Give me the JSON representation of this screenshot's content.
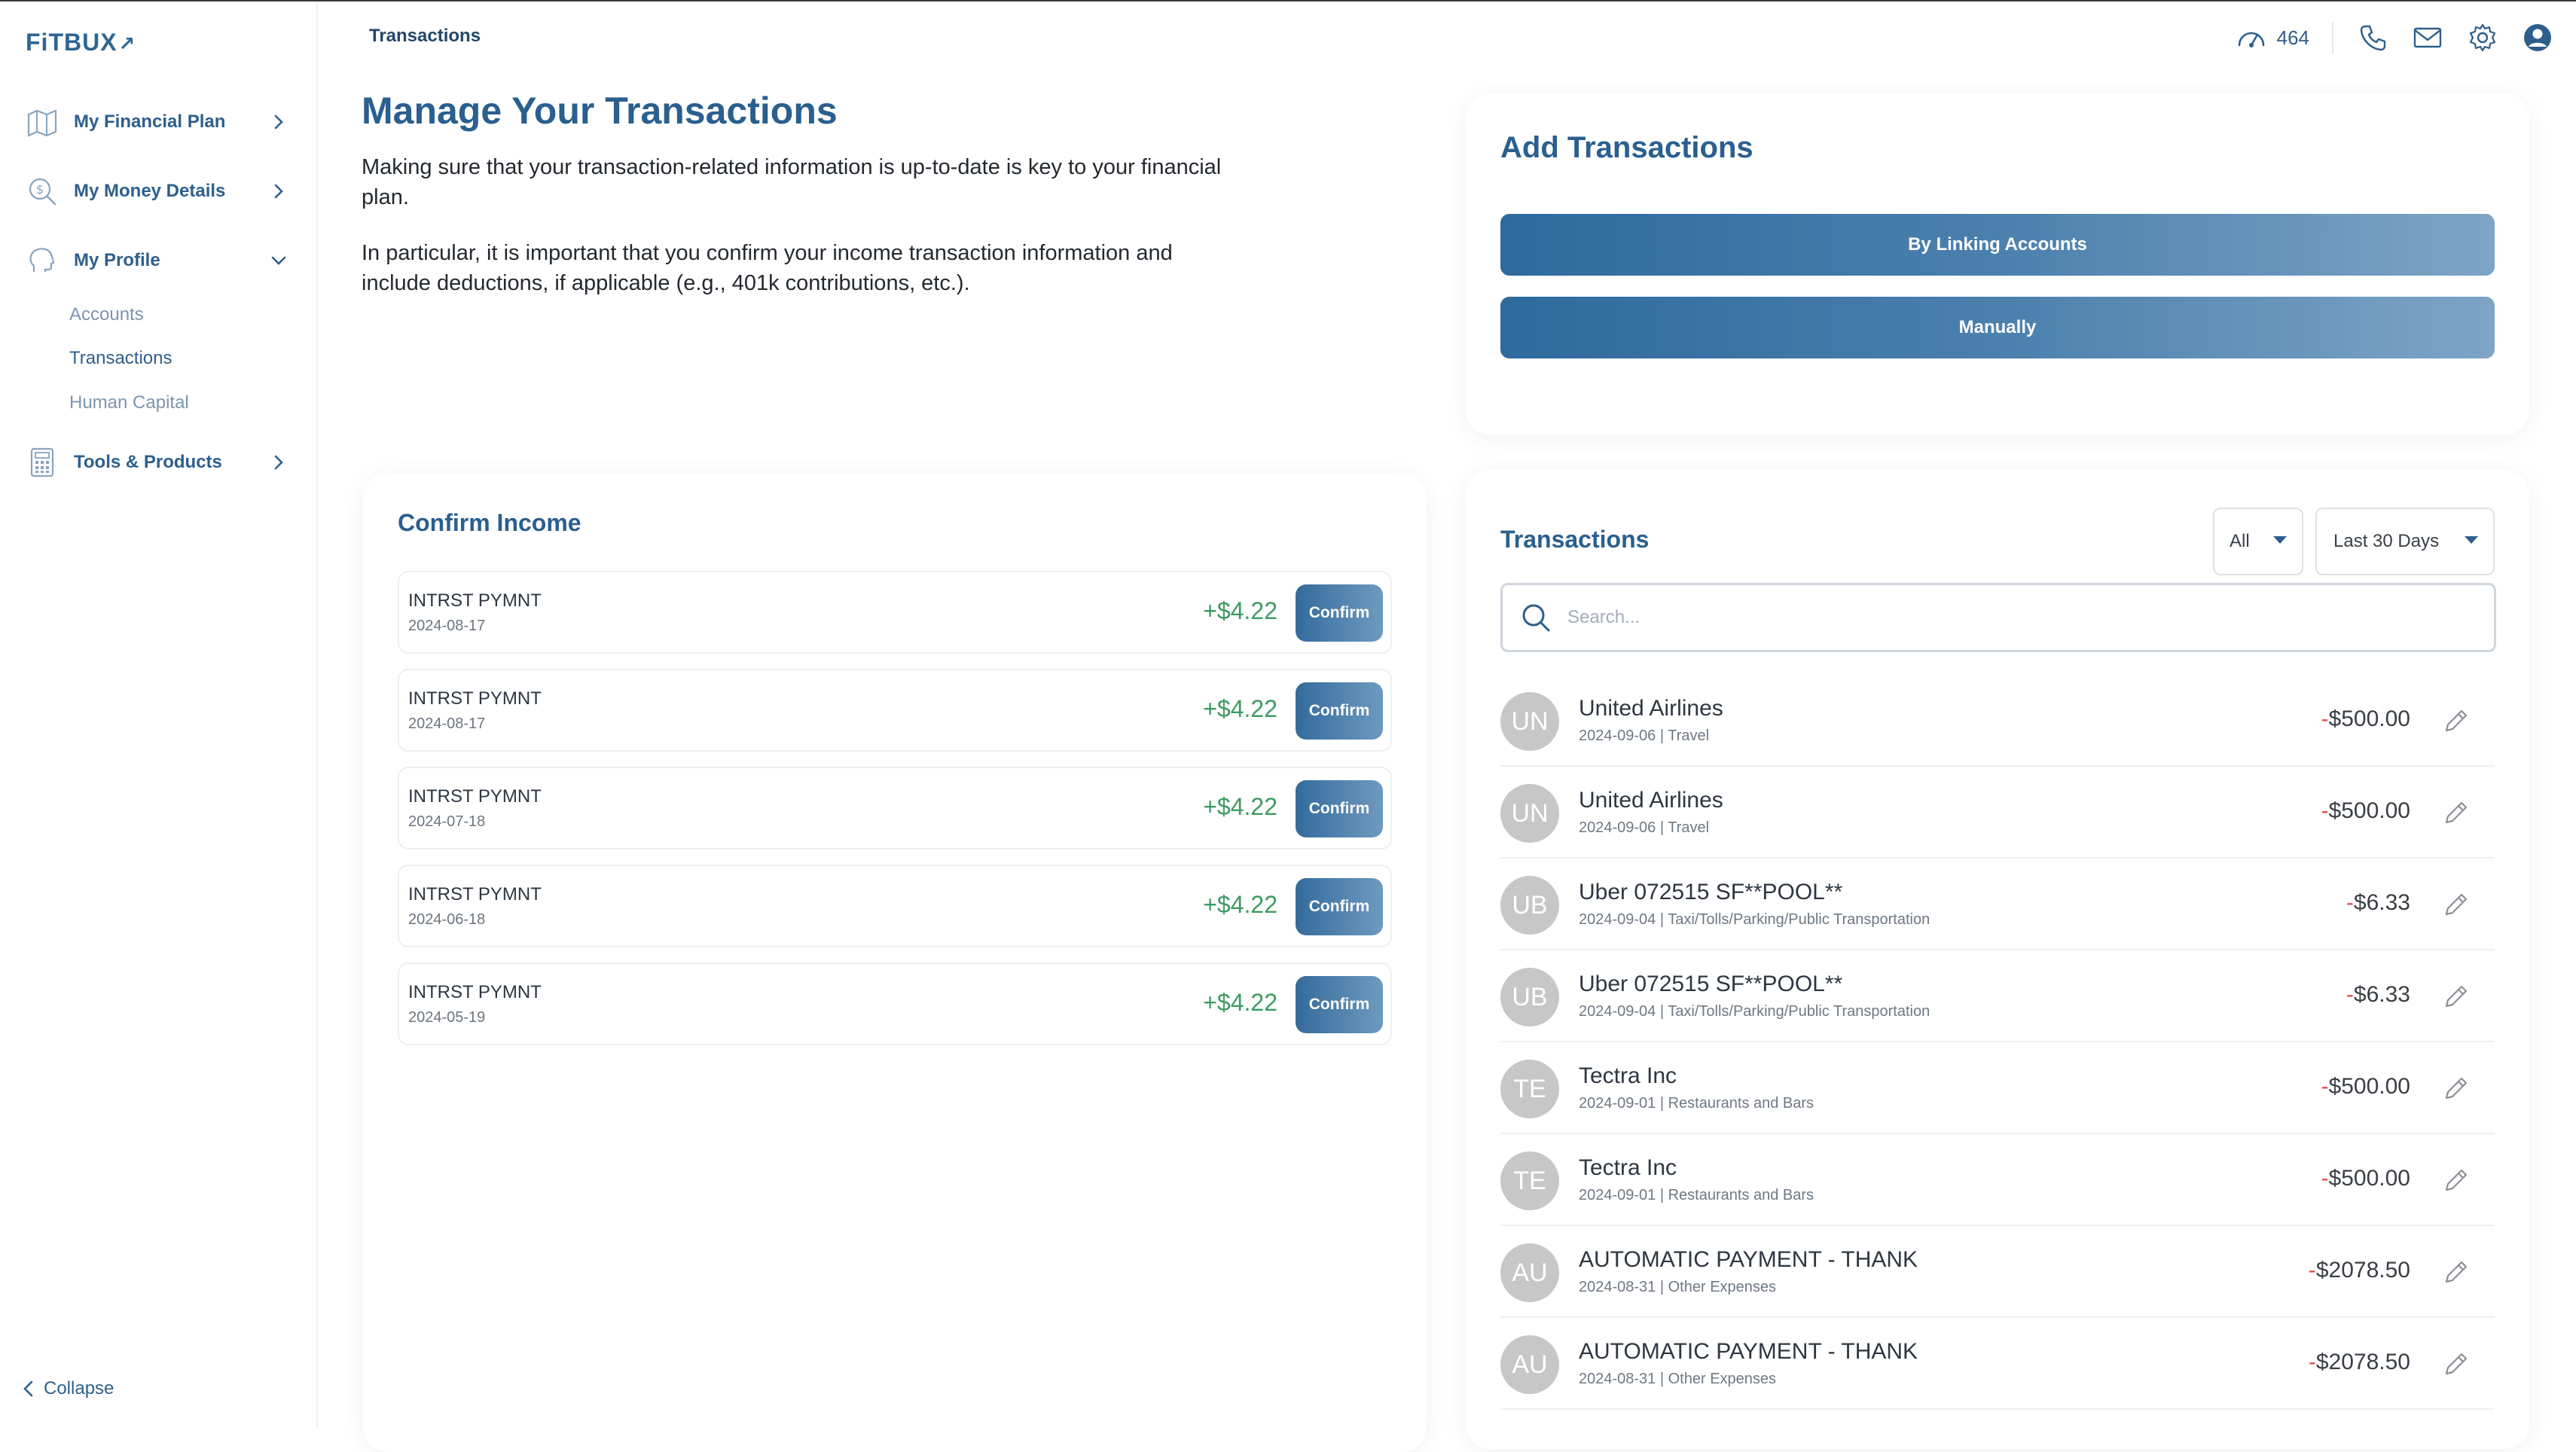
{
  "sidebar": {
    "logo": "FiTBUX",
    "items": [
      {
        "label": "My Financial Plan"
      },
      {
        "label": "My Money Details"
      },
      {
        "label": "My Profile"
      },
      {
        "label": "Tools & Products"
      }
    ],
    "sub_items": [
      "Accounts",
      "Transactions",
      "Human Capital"
    ],
    "collapse_label": "Collapse"
  },
  "header": {
    "breadcrumb": "Transactions",
    "score": "464"
  },
  "intro": {
    "title": "Manage Your Transactions",
    "p1": "Making sure that your transaction-related information is up-to-date is key to your financial plan.",
    "p2": "In particular, it is important that you confirm your income transaction information and include deductions, if applicable (e.g., 401k contributions, etc.)."
  },
  "add": {
    "title": "Add Transactions",
    "btn_link": "By Linking Accounts",
    "btn_manual": "Manually"
  },
  "income": {
    "title": "Confirm Income",
    "confirm_label": "Confirm",
    "rows": [
      {
        "name": "INTRST PYMNT",
        "date": "2024-08-17",
        "amount": "+$4.22"
      },
      {
        "name": "INTRST PYMNT",
        "date": "2024-08-17",
        "amount": "+$4.22"
      },
      {
        "name": "INTRST PYMNT",
        "date": "2024-07-18",
        "amount": "+$4.22"
      },
      {
        "name": "INTRST PYMNT",
        "date": "2024-06-18",
        "amount": "+$4.22"
      },
      {
        "name": "INTRST PYMNT",
        "date": "2024-05-19",
        "amount": "+$4.22"
      }
    ]
  },
  "transactions": {
    "title": "Transactions",
    "filter_type": "All",
    "filter_range": "Last 30 Days",
    "search_placeholder": "Search...",
    "rows": [
      {
        "initials": "UN",
        "name": "United Airlines",
        "meta": "2024-09-06 | Travel",
        "sign": "-",
        "amount": "$500.00"
      },
      {
        "initials": "UN",
        "name": "United Airlines",
        "meta": "2024-09-06 | Travel",
        "sign": "-",
        "amount": "$500.00"
      },
      {
        "initials": "UB",
        "name": "Uber 072515 SF**POOL**",
        "meta": "2024-09-04 | Taxi/Tolls/Parking/Public Transportation",
        "sign": "-",
        "amount": "$6.33"
      },
      {
        "initials": "UB",
        "name": "Uber 072515 SF**POOL**",
        "meta": "2024-09-04 | Taxi/Tolls/Parking/Public Transportation",
        "sign": "-",
        "amount": "$6.33"
      },
      {
        "initials": "TE",
        "name": "Tectra Inc",
        "meta": "2024-09-01 | Restaurants and Bars",
        "sign": "-",
        "amount": "$500.00"
      },
      {
        "initials": "TE",
        "name": "Tectra Inc",
        "meta": "2024-09-01 | Restaurants and Bars",
        "sign": "-",
        "amount": "$500.00"
      },
      {
        "initials": "AU",
        "name": "AUTOMATIC PAYMENT - THANK",
        "meta": "2024-08-31 | Other Expenses",
        "sign": "-",
        "amount": "$2078.50"
      },
      {
        "initials": "AU",
        "name": "AUTOMATIC PAYMENT - THANK",
        "meta": "2024-08-31 | Other Expenses",
        "sign": "-",
        "amount": "$2078.50"
      }
    ]
  },
  "colors": {
    "brand": "#2e5f8c",
    "income_green": "#3d9a62",
    "expense_red": "#d94c4c",
    "avatar_gray": "#c7c7c7"
  }
}
